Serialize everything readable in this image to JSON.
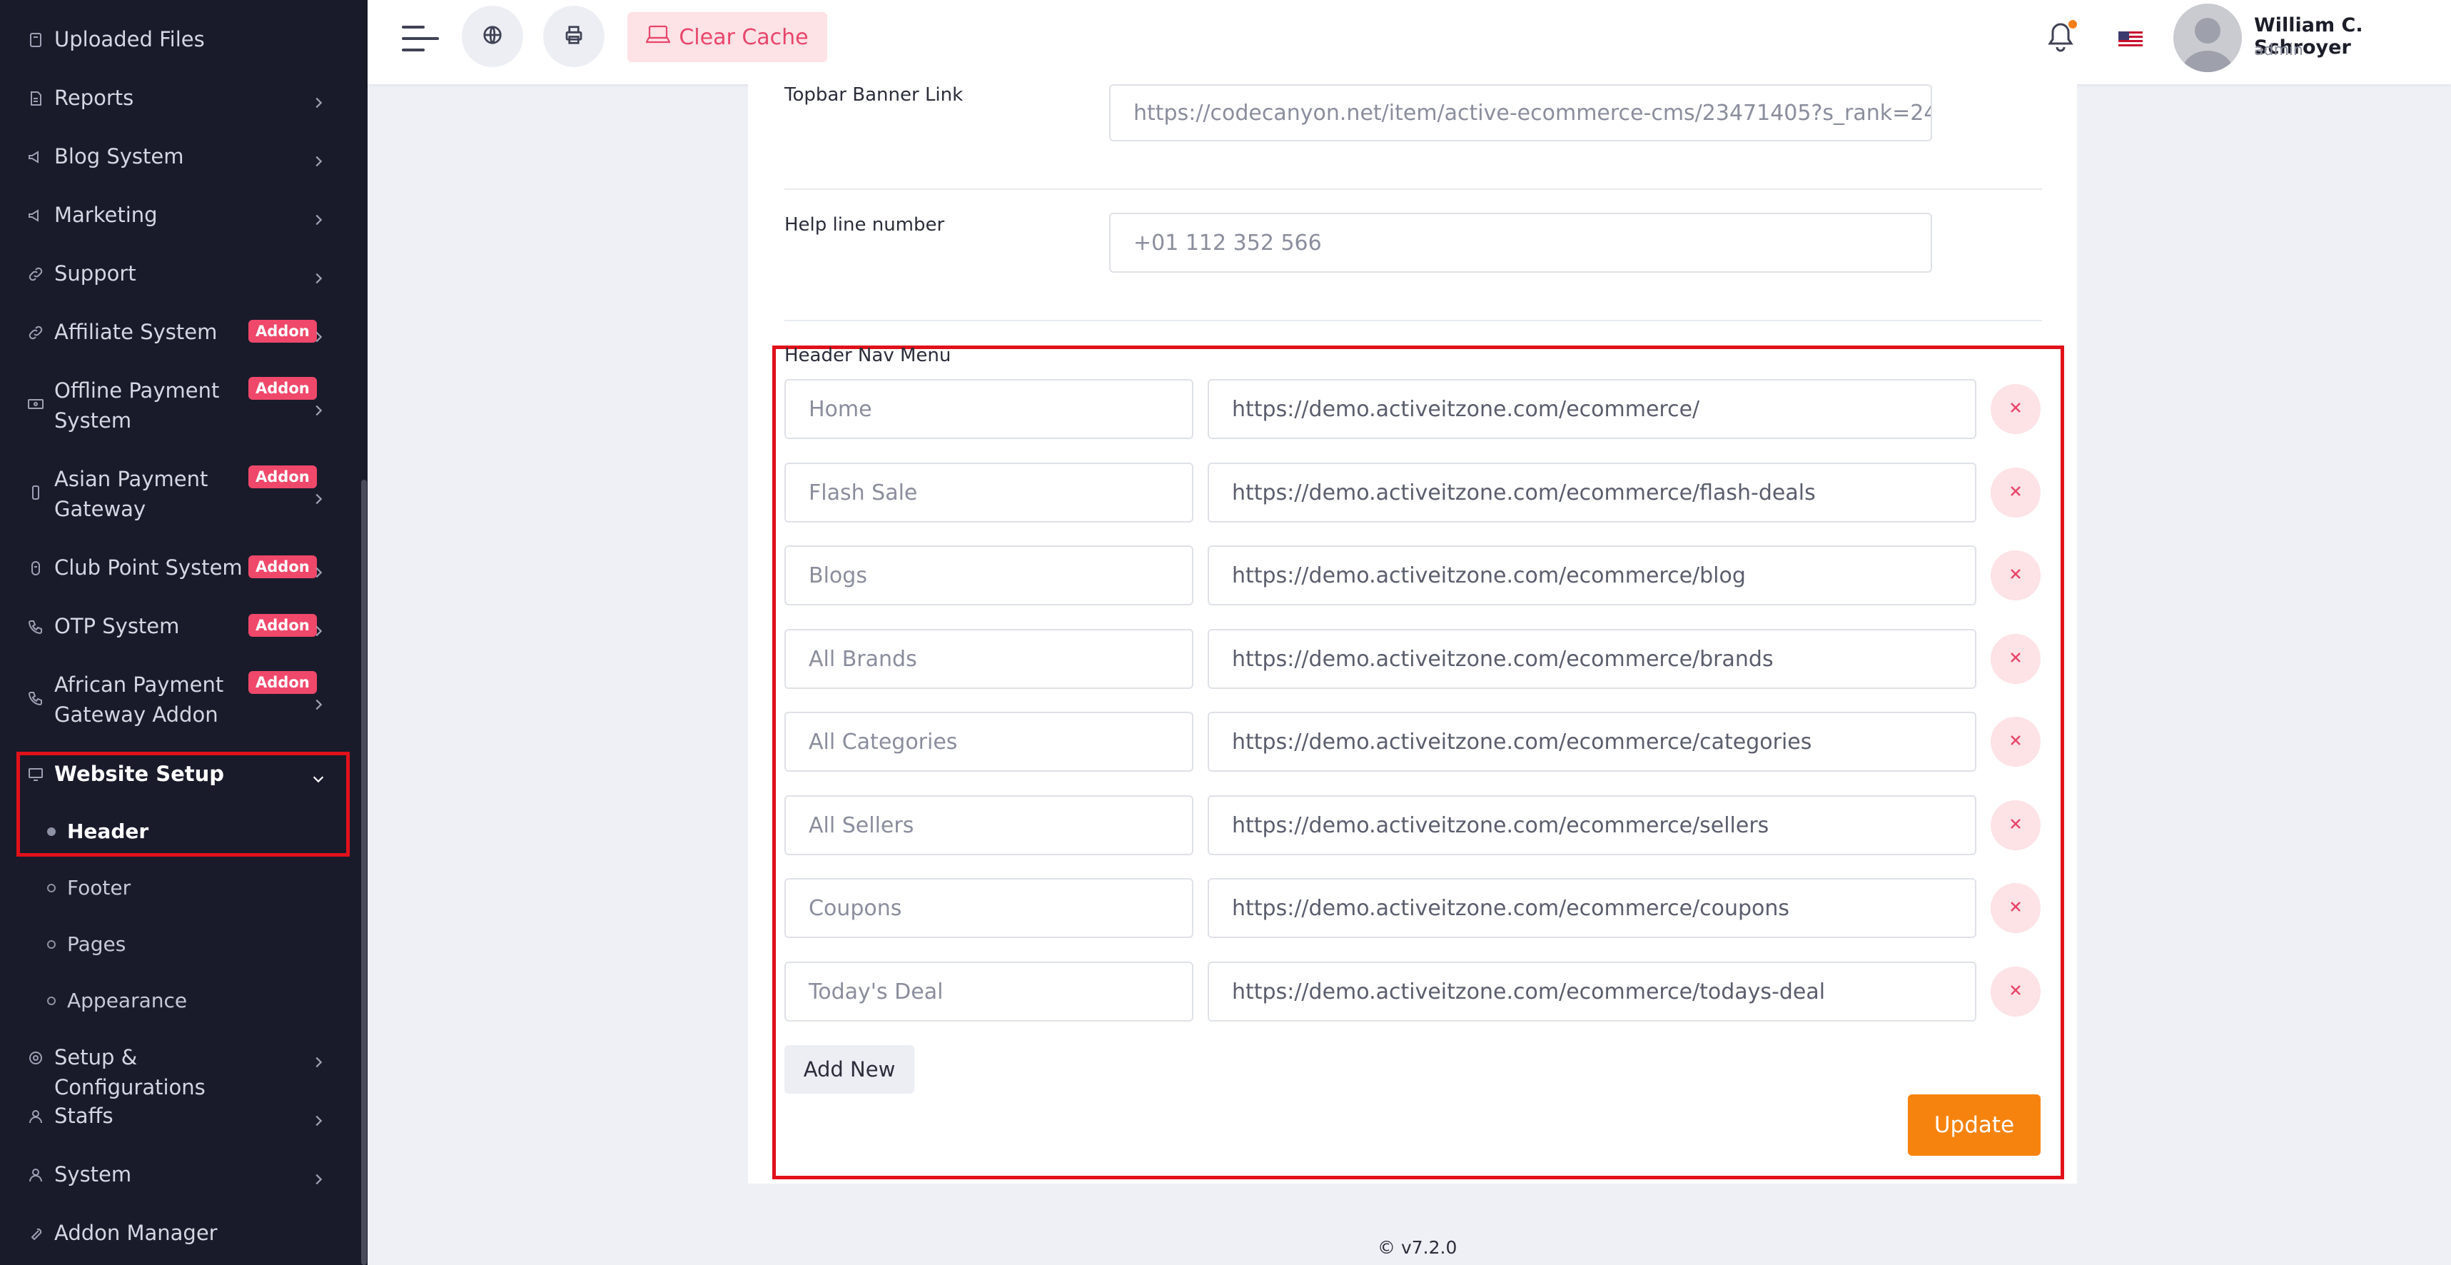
{
  "sidebar": {
    "items": [
      {
        "label": "Uploaded Files",
        "icon": "file-icon",
        "addon": "",
        "chevron": false
      },
      {
        "label": "Reports",
        "icon": "report-icon",
        "addon": "",
        "chevron": true
      },
      {
        "label": "Blog System",
        "icon": "megaphone-icon",
        "addon": "",
        "chevron": true
      },
      {
        "label": "Marketing",
        "icon": "megaphone-icon",
        "addon": "",
        "chevron": true
      },
      {
        "label": "Support",
        "icon": "link-icon",
        "addon": "",
        "chevron": true
      },
      {
        "label": "Affiliate System",
        "icon": "link-icon",
        "addon": "Addon",
        "chevron": true
      },
      {
        "label": "Offline Payment System",
        "icon": "money-icon",
        "addon": "Addon",
        "chevron": true
      },
      {
        "label": "Asian Payment Gateway",
        "icon": "phone-icon",
        "addon": "Addon",
        "chevron": true
      },
      {
        "label": "Club Point System",
        "icon": "coin-icon",
        "addon": "Addon",
        "chevron": true
      },
      {
        "label": "OTP System",
        "icon": "phone-call-icon",
        "addon": "Addon",
        "chevron": true
      },
      {
        "label": "African Payment Gateway Addon",
        "icon": "phone-call-icon",
        "addon": "Addon",
        "chevron": true
      },
      {
        "label": "Website Setup",
        "icon": "monitor-icon",
        "addon": "",
        "chevron": true
      },
      {
        "label": "Setup & Configurations",
        "icon": "gear-icon",
        "addon": "",
        "chevron": true
      },
      {
        "label": "Staffs",
        "icon": "user-icon",
        "addon": "",
        "chevron": true
      },
      {
        "label": "System",
        "icon": "user-icon",
        "addon": "",
        "chevron": true
      },
      {
        "label": "Addon Manager",
        "icon": "wrench-icon",
        "addon": "",
        "chevron": false
      }
    ],
    "website_setup_sub": [
      "Header",
      "Footer",
      "Pages",
      "Appearance"
    ]
  },
  "topbar": {
    "clear_cache": "Clear Cache",
    "user_name": "William C. Schroyer",
    "user_role": "admin"
  },
  "form": {
    "topbar_banner_link_label": "Topbar Banner Link",
    "topbar_banner_link_value": "https://codecanyon.net/item/active-ecommerce-cms/23471405?s_rank=24",
    "help_line_label": "Help line number",
    "help_line_value": "+01 112 352 566",
    "header_nav_menu_label": "Header Nav Menu",
    "nav_items": [
      {
        "label": "Home",
        "url": "https://demo.activeitzone.com/ecommerce/"
      },
      {
        "label": "Flash Sale",
        "url": "https://demo.activeitzone.com/ecommerce/flash-deals"
      },
      {
        "label": "Blogs",
        "url": "https://demo.activeitzone.com/ecommerce/blog"
      },
      {
        "label": "All Brands",
        "url": "https://demo.activeitzone.com/ecommerce/brands"
      },
      {
        "label": "All Categories",
        "url": "https://demo.activeitzone.com/ecommerce/categories"
      },
      {
        "label": "All Sellers",
        "url": "https://demo.activeitzone.com/ecommerce/sellers"
      },
      {
        "label": "Coupons",
        "url": "https://demo.activeitzone.com/ecommerce/coupons"
      },
      {
        "label": "Today's Deal",
        "url": "https://demo.activeitzone.com/ecommerce/todays-deal"
      }
    ],
    "add_new": "Add New",
    "update": "Update"
  },
  "footer": {
    "version": "© v7.2.0"
  },
  "colors": {
    "sidebar_bg": "#191b2b",
    "accent_orange": "#f7830f",
    "addon_badge": "#ef486a",
    "highlight_red": "#e0111a"
  }
}
